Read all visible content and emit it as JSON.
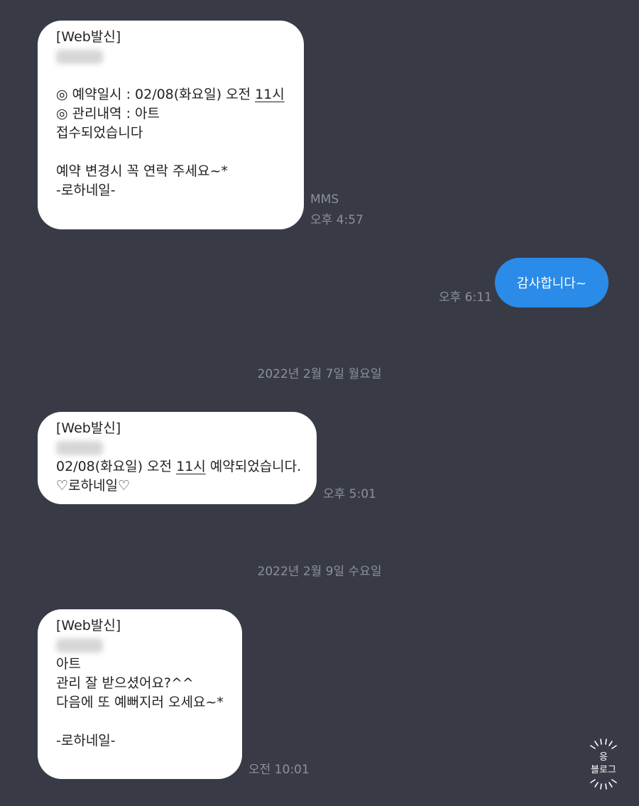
{
  "messages": {
    "m1": {
      "header": "[Web발신]",
      "line1_pre": "◎ 예약일시 : 02/08(화요일) 오전 ",
      "line1_time": "11시",
      "line2": "◎ 관리내역 : 아트",
      "line3": "접수되었습니다",
      "line4": "예약 변경시 꼭 연락 주세요~*",
      "line5": "-로하네일-",
      "type_label": "MMS",
      "time": "오후 4:57"
    },
    "reply": {
      "text": "감사합니다~",
      "time": "오후 6:11"
    },
    "date_sep_1": "2022년 2월 7일 월요일",
    "m2": {
      "header": "[Web발신]",
      "line1_pre": "02/08(화요일) 오전 ",
      "line1_time": "11시",
      "line1_post": " 예약되었습니다.",
      "line2": "♡로하네일♡",
      "time": "오후 5:01"
    },
    "date_sep_2": "2022년 2월 9일 수요일",
    "m3": {
      "header": "[Web발신]",
      "line1": "아트",
      "line2": "관리 잘 받으셨어요?^^",
      "line3": "다음에 또 예뻐지러 오세요~*",
      "line4": "-로하네일-",
      "time": "오전 10:01"
    }
  },
  "watermark": {
    "line1": "응",
    "line2": "블로그"
  },
  "colors": {
    "background": "#383b45",
    "received_bubble": "#ffffff",
    "sent_bubble": "#2b8be8",
    "meta_text": "#8d909b"
  }
}
